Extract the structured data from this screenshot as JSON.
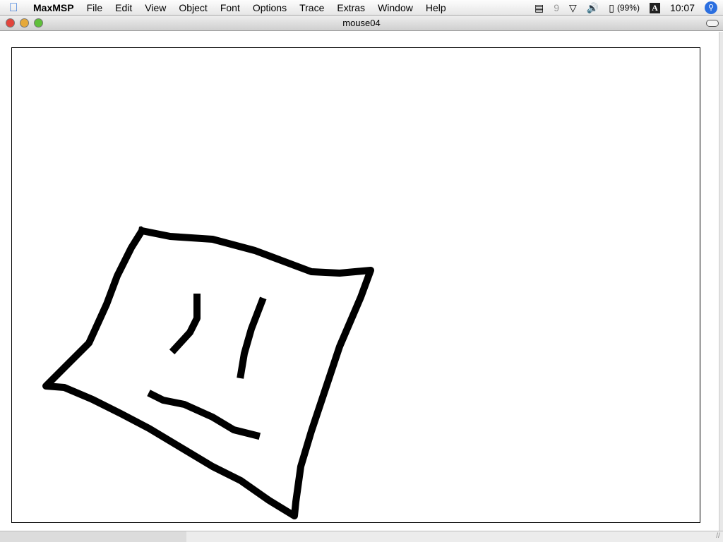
{
  "menubar": {
    "app": "MaxMSP",
    "items": [
      "File",
      "Edit",
      "View",
      "Object",
      "Font",
      "Options",
      "Trace",
      "Extras",
      "Window",
      "Help"
    ],
    "battery": "(99%)",
    "input_menu": "A",
    "clock": "10:07"
  },
  "window": {
    "title": "mouse04"
  },
  "colors": {
    "ink": "#000000",
    "canvas": "#ffffff"
  }
}
